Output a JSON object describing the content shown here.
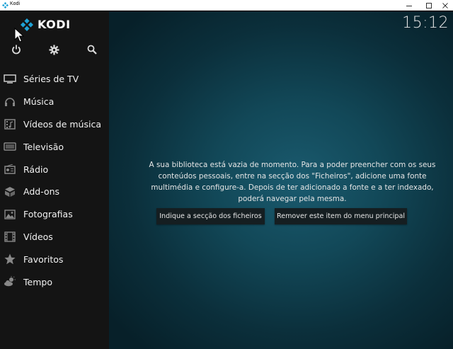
{
  "window": {
    "title": "Kodi"
  },
  "app": {
    "logo_text": "KODI",
    "clock": "15:12"
  },
  "top_icons": [
    {
      "name": "power-icon"
    },
    {
      "name": "gear-icon"
    },
    {
      "name": "search-icon"
    }
  ],
  "menu": {
    "items": [
      {
        "label": "Séries de TV",
        "icon": "tv-icon"
      },
      {
        "label": "Música",
        "icon": "headphones-icon"
      },
      {
        "label": "Vídeos de música",
        "icon": "music-video-icon"
      },
      {
        "label": "Televisão",
        "icon": "television-icon"
      },
      {
        "label": "Rádio",
        "icon": "radio-icon"
      },
      {
        "label": "Add-ons",
        "icon": "addons-icon"
      },
      {
        "label": "Fotografias",
        "icon": "photo-icon"
      },
      {
        "label": "Vídeos",
        "icon": "film-icon"
      },
      {
        "label": "Favoritos",
        "icon": "star-icon"
      },
      {
        "label": "Tempo",
        "icon": "weather-icon"
      }
    ]
  },
  "main": {
    "message": "A sua biblioteca está vazia de momento. Para a poder preencher com os seus conteúdos pessoais, entre na secção dos \"Ficheiros\", adicione uma fonte multimédia e configure-a. Depois de ter adicionado a fonte e a ter indexado, poderá navegar pela mesma.",
    "buttons": [
      {
        "label": "Indique a secção dos ficheiros"
      },
      {
        "label": "Remover este item do menu principal"
      }
    ]
  },
  "colors": {
    "accent": "#1fa2d6",
    "sidebar": "#141414",
    "background": "#124858"
  }
}
